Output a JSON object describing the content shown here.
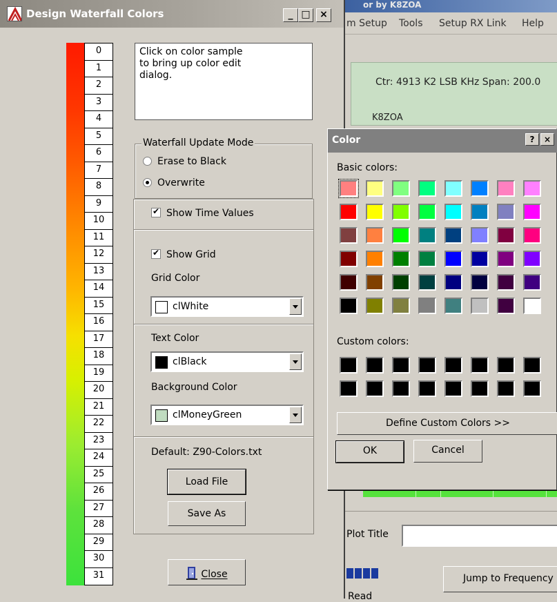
{
  "main_window": {
    "title": "Design Waterfall Colors",
    "caption_buttons": {
      "minimize": "_",
      "maximize": "□",
      "close": "×"
    },
    "scale_labels": [
      "0",
      "1",
      "2",
      "3",
      "4",
      "5",
      "6",
      "7",
      "8",
      "9",
      "10",
      "11",
      "12",
      "13",
      "14",
      "15",
      "16",
      "17",
      "18",
      "19",
      "20",
      "21",
      "22",
      "23",
      "24",
      "25",
      "26",
      "27",
      "28",
      "29",
      "30",
      "31"
    ],
    "instructions": "Click on color sample\nto bring up color edit\ndialog.",
    "update_mode": {
      "legend": "Waterfall Update Mode",
      "options": [
        {
          "label": "Erase to Black",
          "selected": false
        },
        {
          "label": "Overwrite",
          "selected": true
        }
      ]
    },
    "show_time_values": {
      "label": "Show Time Values",
      "checked": true
    },
    "show_grid": {
      "label": "Show Grid",
      "checked": true
    },
    "grid_color": {
      "label": "Grid Color",
      "value": "clWhite",
      "swatch": "#ffffff"
    },
    "text_color": {
      "label": "Text Color",
      "value": "clBlack",
      "swatch": "#000000"
    },
    "background_color": {
      "label": "Background Color",
      "value": "clMoneyGreen",
      "swatch": "#c0dcc0"
    },
    "default_file": "Default: Z90-Colors.txt",
    "load_button": "Load File",
    "save_button": "Save As",
    "close_button": "Close"
  },
  "background_app": {
    "title_fragment": "or by K8ZOA",
    "menu": [
      "m Setup",
      "Tools",
      "Setup RX Link",
      "Help"
    ],
    "center_info": "Ctr: 4913 K2 LSB KHz  Span: 200.0",
    "callsign": "K8ZOA",
    "plot_title_label": "Plot Title",
    "plot_title_value": "",
    "jump_button": "Jump to Frequency",
    "status": "Read"
  },
  "color_dialog": {
    "title": "Color",
    "help_button": "?",
    "close_button": "×",
    "basic_colors_label": "Basic colors:",
    "basic_colors": [
      [
        "#ff8080",
        "#ffff80",
        "#80ff80",
        "#00ff80",
        "#80ffff",
        "#0080ff",
        "#ff80c0",
        "#ff80ff"
      ],
      [
        "#ff0000",
        "#ffff00",
        "#80ff00",
        "#00ff40",
        "#00ffff",
        "#0080c0",
        "#8080c0",
        "#ff00ff"
      ],
      [
        "#804040",
        "#ff8040",
        "#00ff00",
        "#008080",
        "#004080",
        "#8080ff",
        "#800040",
        "#ff0080"
      ],
      [
        "#800000",
        "#ff8000",
        "#008000",
        "#008040",
        "#0000ff",
        "#0000a0",
        "#800080",
        "#8000ff"
      ],
      [
        "#400000",
        "#804000",
        "#004000",
        "#004040",
        "#000080",
        "#000040",
        "#400040",
        "#400080"
      ],
      [
        "#000000",
        "#808000",
        "#808040",
        "#808080",
        "#408080",
        "#c0c0c0",
        "#400040",
        "#ffffff"
      ]
    ],
    "selected_basic": [
      0,
      0
    ],
    "custom_colors_label": "Custom colors:",
    "custom_colors": [
      [
        "#000000",
        "#000000",
        "#000000",
        "#000000",
        "#000000",
        "#000000",
        "#000000",
        "#000000"
      ],
      [
        "#000000",
        "#000000",
        "#000000",
        "#000000",
        "#000000",
        "#000000",
        "#000000",
        "#000000"
      ]
    ],
    "define_custom_button": "Define Custom Colors >>",
    "ok_button": "OK",
    "cancel_button": "Cancel"
  }
}
